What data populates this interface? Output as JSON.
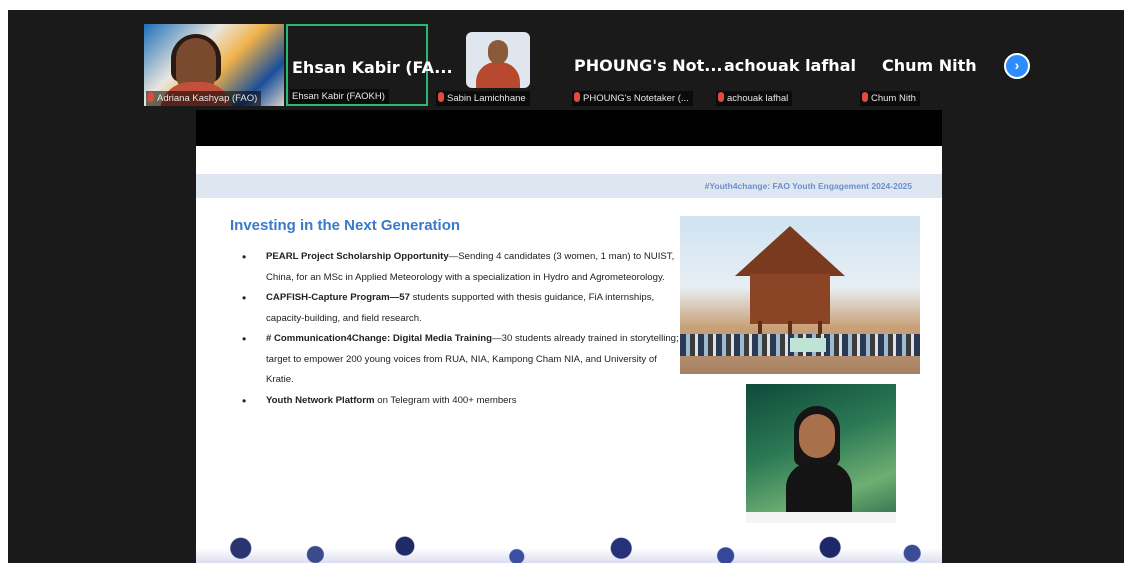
{
  "participants": [
    {
      "label": "Adriana Kashyap (FAO)",
      "big_name": ""
    },
    {
      "label": "Ehsan Kabir (FAOKH)",
      "big_name": "Ehsan Kabir (FA..."
    },
    {
      "label": "Sabin Lamichhane",
      "big_name": ""
    },
    {
      "label": "PHOUNG's Notetaker (...",
      "big_name": "PHOUNG's Not..."
    },
    {
      "label": "achouak lafhal",
      "big_name": "achouak lafhal"
    },
    {
      "label": "Chum Nith",
      "big_name": "Chum Nith"
    }
  ],
  "next_button": "›",
  "slide": {
    "banner": "#Youth4change: FAO Youth Engagement 2024-2025",
    "heading": "Investing in the Next Generation",
    "bullets": [
      {
        "bold": "PEARL Project Scholarship Opportunity",
        "text": "—Sending 4 candidates (3 women, 1 man) to NUIST, China, for an MSc in Applied Meteorology with a specialization in Hydro and Agrometeorology."
      },
      {
        "bold": "CAPFISH-Capture Program—57",
        "text": " students supported with thesis guidance, FiA internships, capacity-building, and field research."
      },
      {
        "bold": "# Communication4Change: Digital Media Training",
        "text": "—30 students already trained in storytelling; target to empower 200 young voices from RUA, NIA, Kampong Cham NIA, and University of Kratie."
      },
      {
        "bold": "Youth Network Platform",
        "text": " on Telegram with 400+ members"
      }
    ]
  },
  "colors": {
    "active_border": "#2bb673",
    "heading": "#3a7ac8",
    "mic_muted": "#e04b3a",
    "next_button": "#2d8cff"
  }
}
